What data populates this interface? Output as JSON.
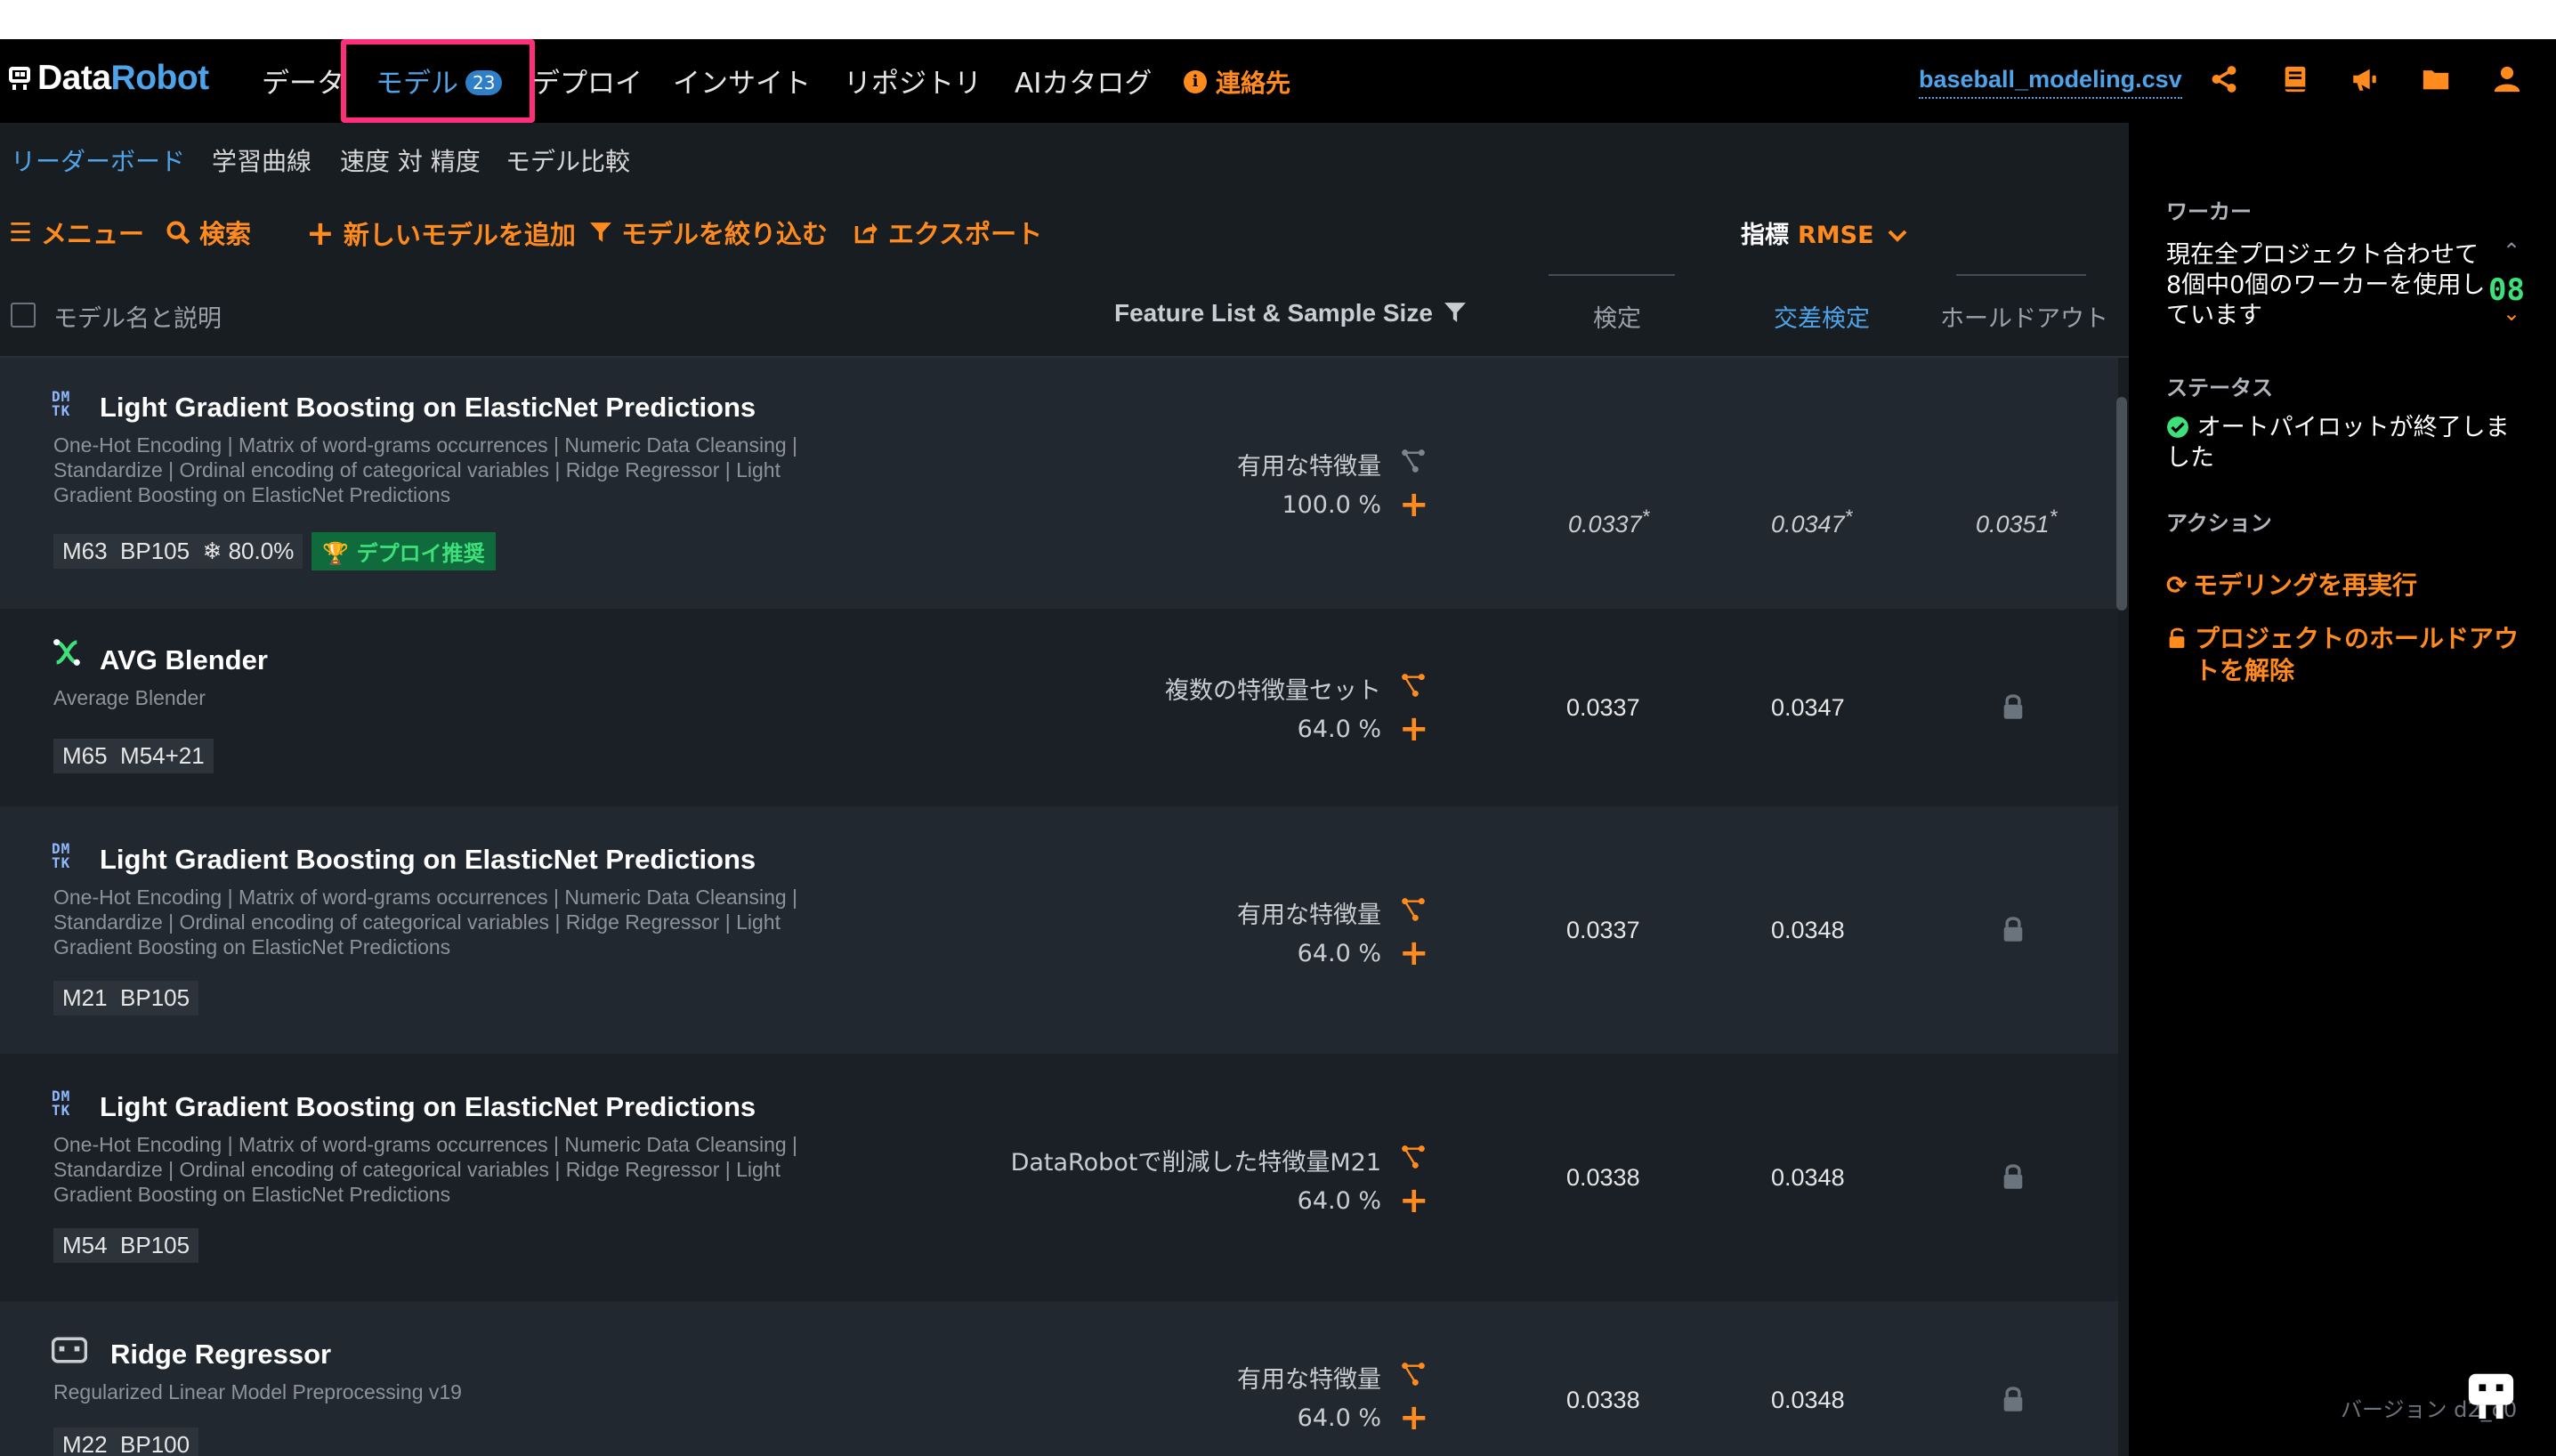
{
  "nav": {
    "logo_data": "Data",
    "logo_robot": "Robot",
    "data": "データ",
    "models": "モデル",
    "models_count": "23",
    "deploy": "デプロイ",
    "insight": "インサイト",
    "repository": "リポジトリ",
    "ai_catalog": "AIカタログ",
    "contact": "連絡先",
    "project_file": "baseball_modeling.csv",
    "icons": [
      "share-icon",
      "book-icon",
      "megaphone-icon",
      "folder-icon",
      "user-icon"
    ],
    "accent_color": "#ff8a1e",
    "link_color": "#4fa3e8",
    "highlight_color": "#ff2e7a"
  },
  "subnav": {
    "leaderboard": "リーダーボード",
    "learning_curve": "学習曲線",
    "speed_vs_accuracy": "速度 対 精度",
    "model_compare": "モデル比較"
  },
  "toolbar": {
    "menu": "メニュー",
    "search": "検索",
    "add_model": "新しいモデルを追加",
    "filter_models": "モデルを絞り込む",
    "export": "エクスポート",
    "metric_label": "指標",
    "metric_value": "RMSE"
  },
  "table": {
    "headers": {
      "name": "モデル名と説明",
      "feature_list": "Feature List & Sample Size",
      "validation": "検定",
      "cross_validation": "交差検定",
      "holdout": "ホールドアウト"
    },
    "rows": [
      {
        "icon": "dmtk-icon",
        "icon_line1": "DM",
        "icon_line2": "TK",
        "title": "Light Gradient Boosting on ElasticNet Predictions",
        "desc": "One-Hot Encoding | Matrix of word-grams occurrences | Numeric Data Cleansing | Standardize | Ordinal encoding of categorical variables | Ridge Regressor | Light Gradient Boosting on ElasticNet Predictions",
        "tag1": "M63",
        "tag2": "BP105",
        "tag3": "80.0%",
        "deploy_badge": "デプロイ推奨",
        "feature_list": "有用な特徴量",
        "sample": "100.0 %",
        "validation": "0.0337",
        "validation_star": "*",
        "cv": "0.0347",
        "cv_star": "*",
        "holdout": "0.0351",
        "holdout_star": "*"
      },
      {
        "icon": "blender-icon",
        "title": "AVG Blender",
        "desc": "Average Blender",
        "tag1": "M65",
        "tag2": "M54+21",
        "feature_list": "複数の特徴量セット",
        "sample": "64.0 %",
        "validation": "0.0337",
        "cv": "0.0347"
      },
      {
        "icon": "dmtk-icon",
        "icon_line1": "DM",
        "icon_line2": "TK",
        "title": "Light Gradient Boosting on ElasticNet Predictions",
        "desc": "One-Hot Encoding | Matrix of word-grams occurrences | Numeric Data Cleansing | Standardize | Ordinal encoding of categorical variables | Ridge Regressor | Light Gradient Boosting on ElasticNet Predictions",
        "tag1": "M21",
        "tag2": "BP105",
        "feature_list": "有用な特徴量",
        "sample": "64.0 %",
        "validation": "0.0337",
        "cv": "0.0348"
      },
      {
        "icon": "dmtk-icon",
        "icon_line1": "DM",
        "icon_line2": "TK",
        "title": "Light Gradient Boosting on ElasticNet Predictions",
        "desc": "One-Hot Encoding | Matrix of word-grams occurrences | Numeric Data Cleansing | Standardize | Ordinal encoding of categorical variables | Ridge Regressor | Light Gradient Boosting on ElasticNet Predictions",
        "tag1": "M54",
        "tag2": "BP105",
        "feature_list": "DataRobotで削減した特徴量M21",
        "sample": "64.0 %",
        "validation": "0.0338",
        "cv": "0.0348"
      },
      {
        "icon": "regressor-icon",
        "title": "Ridge Regressor",
        "desc": "Regularized Linear Model Preprocessing v19",
        "tag1": "M22",
        "tag2": "BP100",
        "feature_list": "有用な特徴量",
        "sample": "64.0 %",
        "validation": "0.0338",
        "cv": "0.0348"
      }
    ]
  },
  "panel": {
    "worker_heading": "ワーカー",
    "worker_text": "現在全プロジェクト合わせて8個中0個のワーカーを使用しています",
    "worker_count": "08",
    "status_heading": "ステータス",
    "status_text": "オートパイロットが終了しました",
    "action_heading": "アクション",
    "rerun_modeling": "モデリングを再実行",
    "unlock_holdout": "プロジェクトのホールドアウトを解除",
    "version": "バージョン d2_c0"
  }
}
